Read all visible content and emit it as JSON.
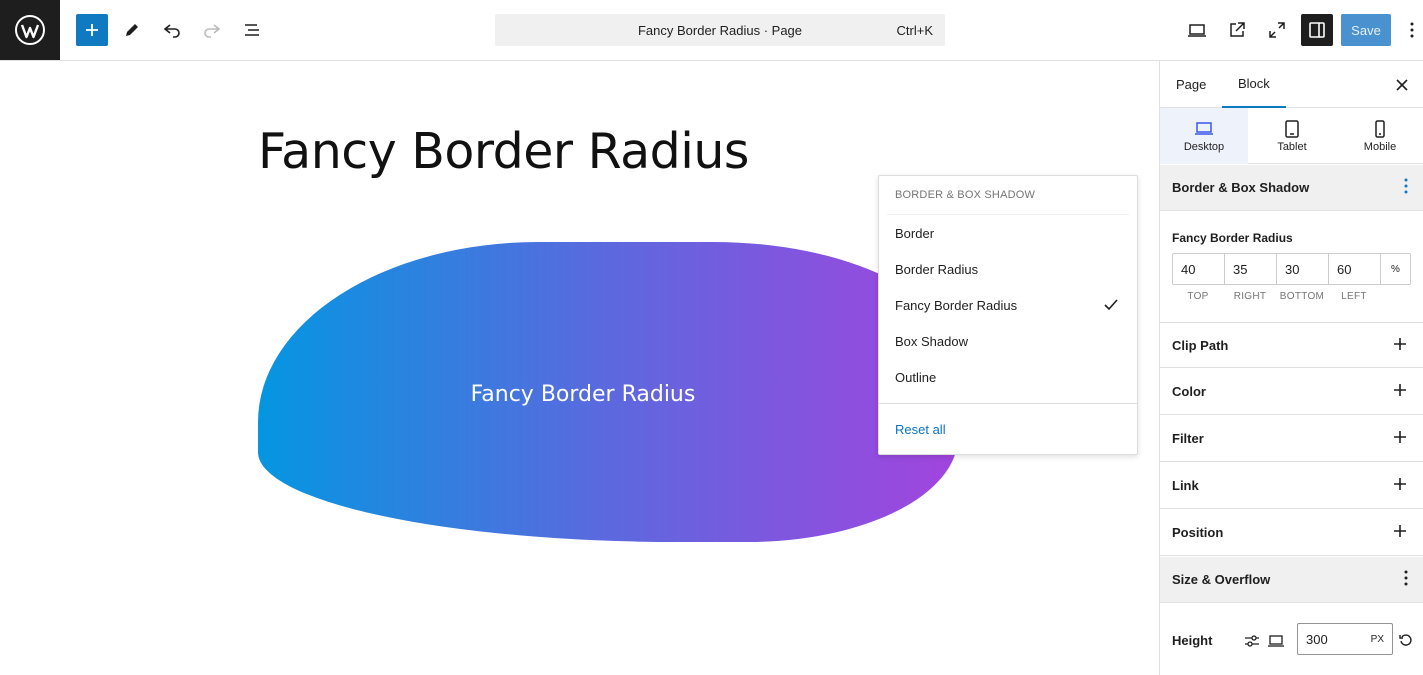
{
  "toolbar": {
    "logo": "wordpress-icon",
    "document_title": "Fancy Border Radius · Page",
    "shortcut": "Ctrl+K",
    "save_label": "Save",
    "accent": "#0f79c1"
  },
  "canvas": {
    "heading": "Fancy Border Radius",
    "block_text": "Fancy Border Radius",
    "gradient": [
      "#0496e0",
      "#a244de"
    ]
  },
  "dropdown": {
    "heading": "BORDER & BOX SHADOW",
    "items": [
      {
        "label": "Border",
        "checked": false
      },
      {
        "label": "Border Radius",
        "checked": false
      },
      {
        "label": "Fancy Border Radius",
        "checked": true
      },
      {
        "label": "Box Shadow",
        "checked": false
      },
      {
        "label": "Outline",
        "checked": false
      }
    ],
    "reset": "Reset all"
  },
  "sidebar": {
    "tabs": [
      "Page",
      "Block"
    ],
    "active_tab": "Block",
    "devices": [
      "Desktop",
      "Tablet",
      "Mobile"
    ],
    "active_device": "Desktop",
    "border_panel": {
      "title": "Border & Box Shadow",
      "control_label": "Fancy Border Radius",
      "values": {
        "top": "40",
        "right": "35",
        "bottom": "30",
        "left": "60"
      },
      "unit": "%",
      "side_labels": [
        "TOP",
        "RIGHT",
        "BOTTOM",
        "LEFT"
      ]
    },
    "panels": [
      "Clip Path",
      "Color",
      "Filter",
      "Link",
      "Position"
    ],
    "size_panel": {
      "title": "Size & Overflow",
      "height_label": "Height",
      "height_value": "300",
      "height_unit": "PX"
    }
  }
}
